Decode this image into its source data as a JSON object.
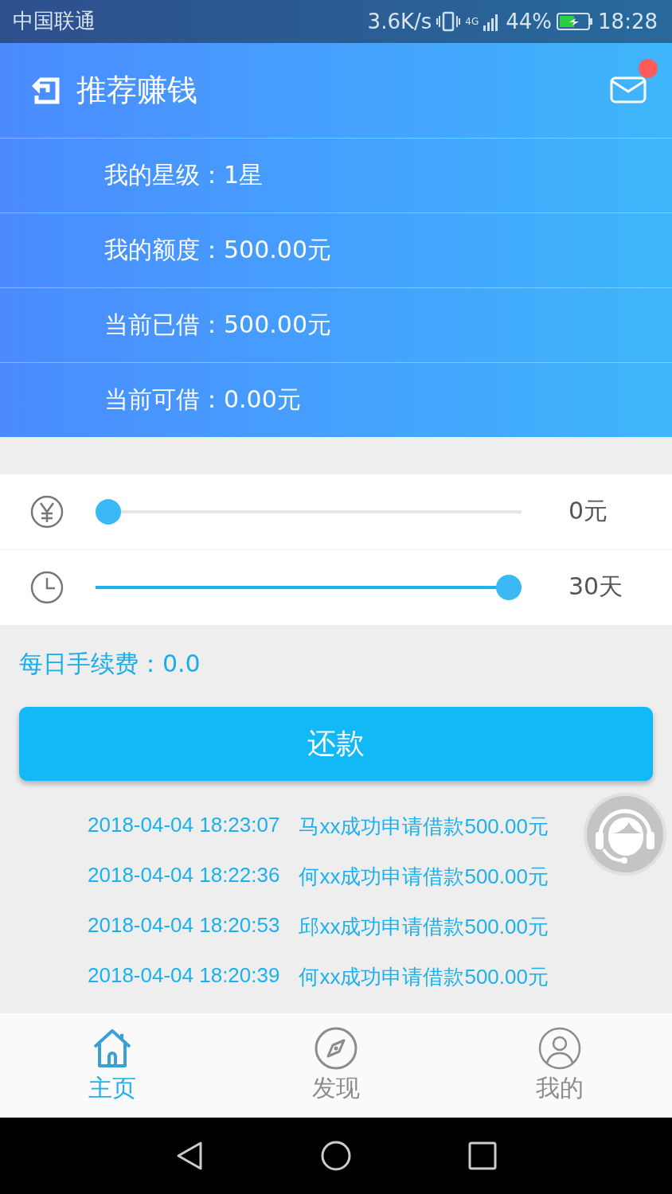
{
  "status_bar": {
    "carrier": "中国联通",
    "speed": "3.6K/s",
    "network": "4G",
    "battery": "44%",
    "time": "18:28"
  },
  "header": {
    "title": "推荐赚钱",
    "has_new_message": true
  },
  "info_rows": [
    {
      "label": "我的星级：",
      "value": "1星"
    },
    {
      "label": "我的额度：",
      "value": "500.00元"
    },
    {
      "label": "当前已借：",
      "value": "500.00元"
    },
    {
      "label": "当前可借：",
      "value": "0.00元"
    }
  ],
  "sliders": [
    {
      "kind": "amount",
      "level": 0,
      "reading": "0元"
    },
    {
      "kind": "days",
      "level": 1,
      "reading": "30天"
    }
  ],
  "daily_fee": "每日手续费：0.0",
  "repay_button": "还款",
  "records": [
    {
      "time": "2018-04-04 18:23:07",
      "text": "马xx成功申请借款500.00元"
    },
    {
      "time": "2018-04-04 18:22:36",
      "text": "何xx成功申请借款500.00元"
    },
    {
      "time": "2018-04-04 18:20:53",
      "text": "邱xx成功申请借款500.00元"
    },
    {
      "time": "2018-04-04 18:20:39",
      "text": "何xx成功申请借款500.00元"
    }
  ],
  "tabs": [
    {
      "kind": "home",
      "label": "主页",
      "selected": true
    },
    {
      "kind": "discover",
      "label": "发现",
      "selected": false
    },
    {
      "kind": "me",
      "label": "我的",
      "selected": false
    }
  ]
}
